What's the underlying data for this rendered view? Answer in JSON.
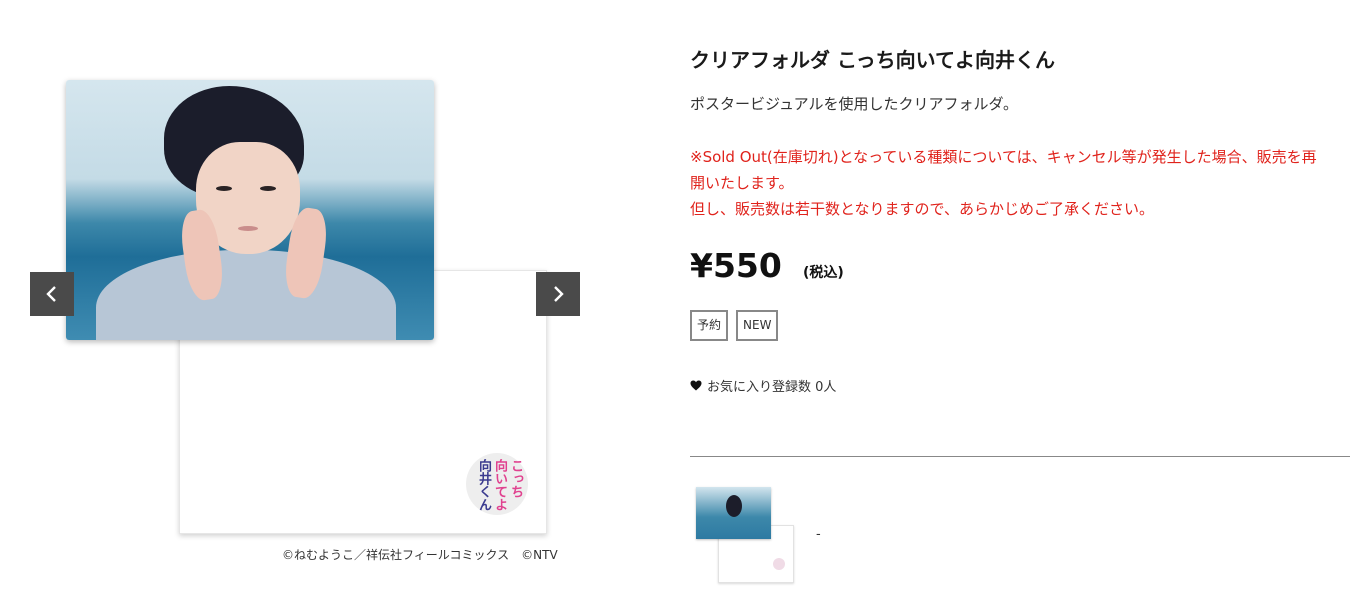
{
  "gallery": {
    "prev_label": "‹",
    "next_label": "›",
    "logo_text_col1": "こっち",
    "logo_text_col2": "向いてよ",
    "logo_text_col3": "向井くん",
    "copyright": "©ねむようこ／祥伝社フィールコミックス　©NTV"
  },
  "product": {
    "title": "クリアフォルダ こっち向いてよ向井くん",
    "description": "ポスタービジュアルを使用したクリアフォルダ。",
    "notice_lines": [
      "※Sold Out(在庫切れ)となっている種類については、キャンセル等が発生した場合、販売を再開いたします。",
      "但し、販売数は若干数となりますので、あらかじめご了承ください。"
    ],
    "price": "¥550",
    "tax_label": "(税込)",
    "badges": [
      "予約",
      "NEW"
    ],
    "favorite_text": "お気に入り登録数 0人",
    "variant_label": "-"
  },
  "colors": {
    "notice": "#e0231c",
    "nav_button": "#4a4a4a"
  },
  "icons": {
    "favorite": "heart-icon",
    "prev": "chevron-left-icon",
    "next": "chevron-right-icon"
  }
}
